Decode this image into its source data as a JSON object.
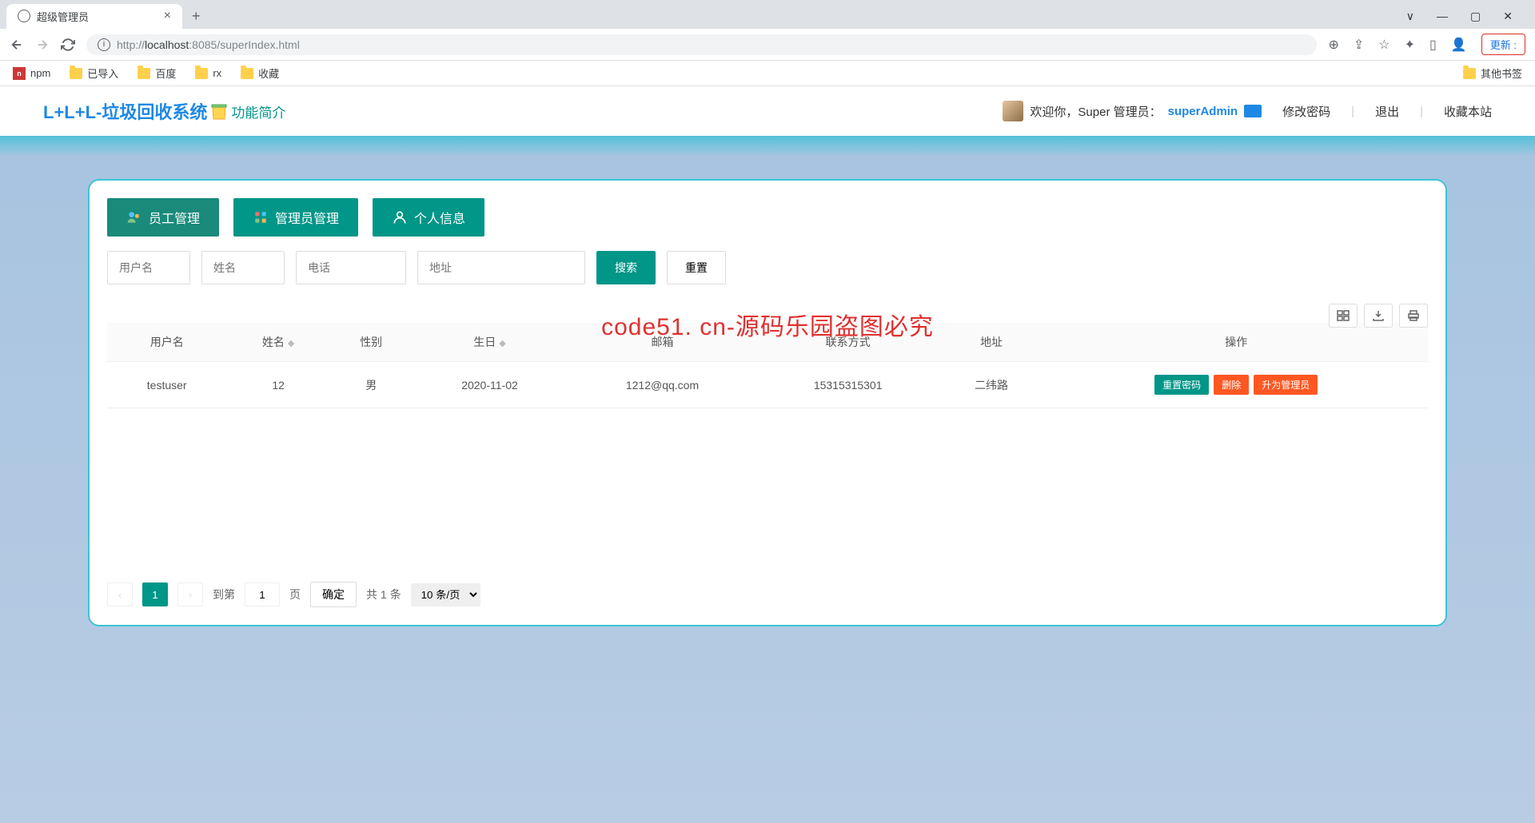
{
  "browser": {
    "tab_title": "超级管理员",
    "url": "http://localhost:8085/superIndex.html",
    "url_display_prefix": "http://",
    "url_display_host": "localhost",
    "url_display_rest": ":8085/superIndex.html",
    "update_btn": "更新 :",
    "bookmarks": {
      "npm": "npm",
      "imported": "已导入",
      "baidu": "百度",
      "rx": "rx",
      "fav": "收藏",
      "other": "其他书签"
    }
  },
  "header": {
    "logo": "L+L+L-垃圾回收系统",
    "feature": "功能简介",
    "welcome_prefix": "欢迎你，Super 管理员：",
    "admin_name": "superAdmin",
    "change_pwd": "修改密码",
    "logout": "退出",
    "favorite": "收藏本站"
  },
  "nav": {
    "staff": "员工管理",
    "admin": "管理员管理",
    "profile": "个人信息"
  },
  "search": {
    "username_ph": "用户名",
    "name_ph": "姓名",
    "phone_ph": "电话",
    "address_ph": "地址",
    "search_btn": "搜索",
    "reset_btn": "重置"
  },
  "watermark": "code51. cn-源码乐园盗图必究",
  "table": {
    "cols": {
      "username": "用户名",
      "name": "姓名",
      "gender": "性别",
      "birthday": "生日",
      "email": "邮箱",
      "contact": "联系方式",
      "address": "地址",
      "action": "操作"
    },
    "row": {
      "username": "testuser",
      "name": "12",
      "gender": "男",
      "birthday": "2020-11-02",
      "email": "1212@qq.com",
      "contact": "15315315301",
      "address": "二纬路"
    },
    "actions": {
      "reset_pwd": "重置密码",
      "delete": "删除",
      "promote": "升为管理员"
    }
  },
  "pagination": {
    "page": "1",
    "goto_prefix": "到第",
    "goto_input": "1",
    "goto_suffix": "页",
    "confirm": "确定",
    "total": "共 1 条",
    "per_page": "10 条/页"
  }
}
